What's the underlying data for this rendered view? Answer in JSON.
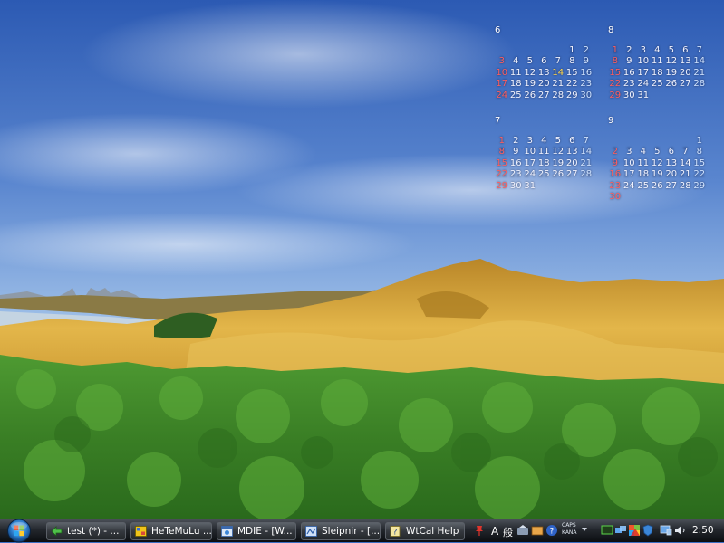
{
  "calendar": {
    "months": [
      {
        "label": "6",
        "lead": 5,
        "days": 30,
        "today": 14
      },
      {
        "label": "8",
        "lead": 0,
        "days": 31,
        "today": null
      },
      {
        "label": "7",
        "lead": 0,
        "days": 31,
        "today": null
      },
      {
        "label": "9",
        "lead": 6,
        "days": 30,
        "today": null
      }
    ],
    "weekend_colors": {
      "sunday": "#ff5e5e",
      "saturday": "#cfe3ff",
      "weekday": "#f2f4ff",
      "today": "#ffd84a"
    }
  },
  "taskbar": {
    "buttons": [
      {
        "label": "test (*) - ...",
        "icon": "arrow-app-icon"
      },
      {
        "label": "HeTeMuLu ...",
        "icon": "hetemulu-app-icon"
      },
      {
        "label": "MDIE - [W...",
        "icon": "mdie-browser-icon"
      },
      {
        "label": "Sleipnir - [...",
        "icon": "sleipnir-browser-icon"
      },
      {
        "label": "WtCal Help",
        "icon": "help-document-icon"
      }
    ],
    "tray": {
      "ime_mode": "A",
      "ime_kanji": "般",
      "caps": "CAPS",
      "kana": "KANA",
      "clock": "2:50"
    }
  },
  "colors": {
    "sky_top": "#2f5fb6",
    "grass": "#d9a53a",
    "shrubs": "#3f8a2b",
    "taskbar": "#1b1e22"
  }
}
